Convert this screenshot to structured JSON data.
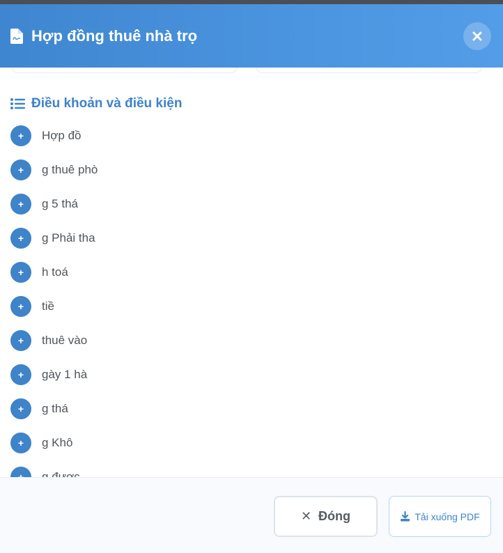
{
  "modal": {
    "title": "Hợp đồng thuê nhà trọ",
    "close_icon": "×"
  },
  "terms_section": {
    "title": "Điều khoản và điều kiện",
    "items": [
      "Hợp đồ",
      "g thuê phò",
      "g 5 thá",
      "g Phải tha",
      "h toá",
      "tiề",
      "thuê vào",
      "gày 1 hà",
      "g thá",
      "g Khô",
      "g được"
    ]
  },
  "footer": {
    "close_label": "Đóng",
    "close_icon": "✕",
    "download_label": "Tải xuống PDF"
  },
  "colors": {
    "header_gradient_start": "#3f86d0",
    "header_gradient_end": "#539de8",
    "accent": "#3f83c9"
  }
}
